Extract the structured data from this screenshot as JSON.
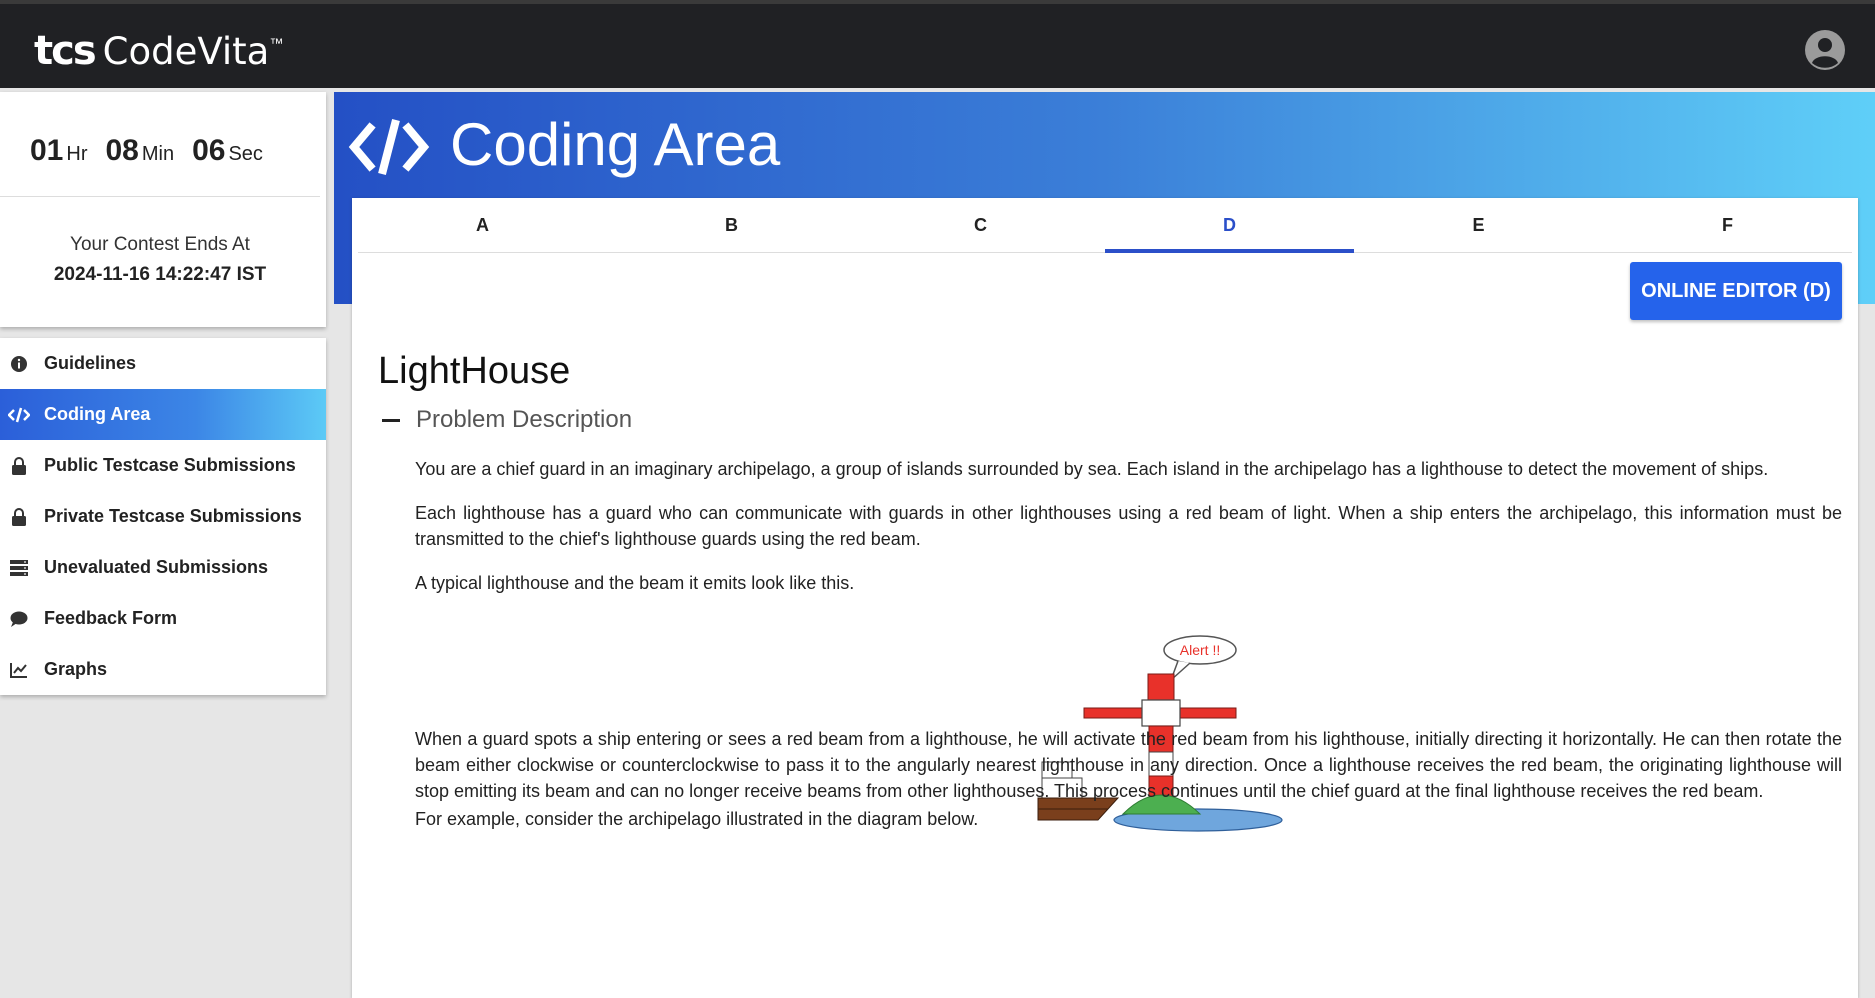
{
  "app": {
    "logo_mark": "tcs",
    "logo_text": "CodeVita",
    "logo_tm": "™"
  },
  "timer": {
    "hours": "01",
    "hours_unit": "Hr",
    "minutes": "08",
    "minutes_unit": "Min",
    "seconds": "06",
    "seconds_unit": "Sec",
    "ends_label": "Your Contest Ends At",
    "ends_value": "2024-11-16 14:22:47 IST"
  },
  "sidebar": {
    "items": [
      {
        "label": "Guidelines",
        "icon": "info-icon",
        "active": false
      },
      {
        "label": "Coding Area",
        "icon": "code-icon",
        "active": true
      },
      {
        "label": "Public Testcase Submissions",
        "icon": "lock-icon",
        "active": false
      },
      {
        "label": "Private Testcase Submissions",
        "icon": "lock-icon",
        "active": false
      },
      {
        "label": "Unevaluated Submissions",
        "icon": "server-icon",
        "active": false
      },
      {
        "label": "Feedback Form",
        "icon": "comment-icon",
        "active": false
      },
      {
        "label": "Graphs",
        "icon": "chart-line-icon",
        "active": false
      }
    ]
  },
  "main": {
    "title": "Coding Area",
    "tabs": [
      "A",
      "B",
      "C",
      "D",
      "E",
      "F"
    ],
    "active_tab": "D",
    "editor_button": "ONLINE EDITOR (D)",
    "problem_title": "LightHouse",
    "section_title": "Problem Description",
    "paragraphs": [
      "You are a chief guard in an imaginary archipelago, a group of islands surrounded by sea. Each island in the archipelago has a lighthouse to detect the movement of ships.",
      "Each lighthouse has a guard who can communicate with guards in other lighthouses using a red beam of light. When a ship enters the archipelago, this information must be transmitted to the chief's lighthouse guards using the red beam.",
      "A typical lighthouse and the beam it emits look like this.",
      "When a guard spots a ship entering or sees a red beam from a lighthouse, he will activate the red beam from his lighthouse, initially directing it horizontally. He can then rotate the beam either clockwise or counterclockwise to pass it to the angularly nearest lighthouse in any direction. Once a lighthouse receives the red beam, the originating lighthouse will stop emitting its beam and can no longer receive beams from other lighthouses. This process continues until the chief guard at the final lighthouse receives the red beam.",
      "For example, consider the archipelago illustrated in the diagram below."
    ],
    "illustration": {
      "alert_text": "Alert !!"
    }
  },
  "colors": {
    "topbar": "#202124",
    "accent": "#2563eb",
    "tab_active": "#2b4fc9",
    "beam_red": "#e8312a"
  }
}
